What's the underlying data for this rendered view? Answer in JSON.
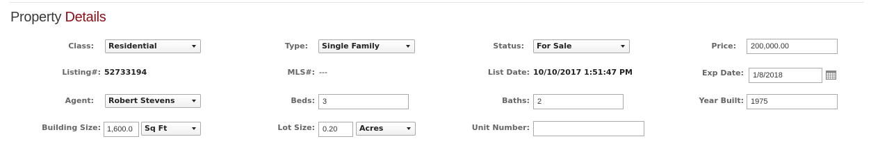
{
  "header": {
    "title_part1": "Property",
    "title_part2": "Details"
  },
  "row1": {
    "class_label": "Class:",
    "class_value": "Residential",
    "type_label": "Type:",
    "type_value": "Single Family",
    "status_label": "Status:",
    "status_value": "For Sale",
    "price_label": "Price:",
    "price_value": "200,000.00"
  },
  "row2": {
    "listing_label": "Listing#:",
    "listing_value": "52733194",
    "mls_label": "MLS#:",
    "mls_value": "---",
    "listdate_label": "List Date:",
    "listdate_value": "10/10/2017 1:51:47 PM",
    "expdate_label": "Exp Date:",
    "expdate_value": "1/8/2018"
  },
  "row3": {
    "agent_label": "Agent:",
    "agent_value": "Robert Stevens",
    "beds_label": "Beds:",
    "beds_value": "3",
    "baths_label": "Baths:",
    "baths_value": "2",
    "yearbuilt_label": "Year Built:",
    "yearbuilt_value": "1975"
  },
  "row4": {
    "bldgsize_label": "Building Size:",
    "bldgsize_value": "1,600.0",
    "bldgsize_unit": "Sq Ft",
    "lotsize_label": "Lot Size:",
    "lotsize_value": "0.20",
    "lotsize_unit": "Acres",
    "unitnum_label": "Unit Number:",
    "unitnum_value": ""
  },
  "icons": {
    "calendar": "calendar-icon",
    "dropdown": "chevron-down-icon"
  }
}
